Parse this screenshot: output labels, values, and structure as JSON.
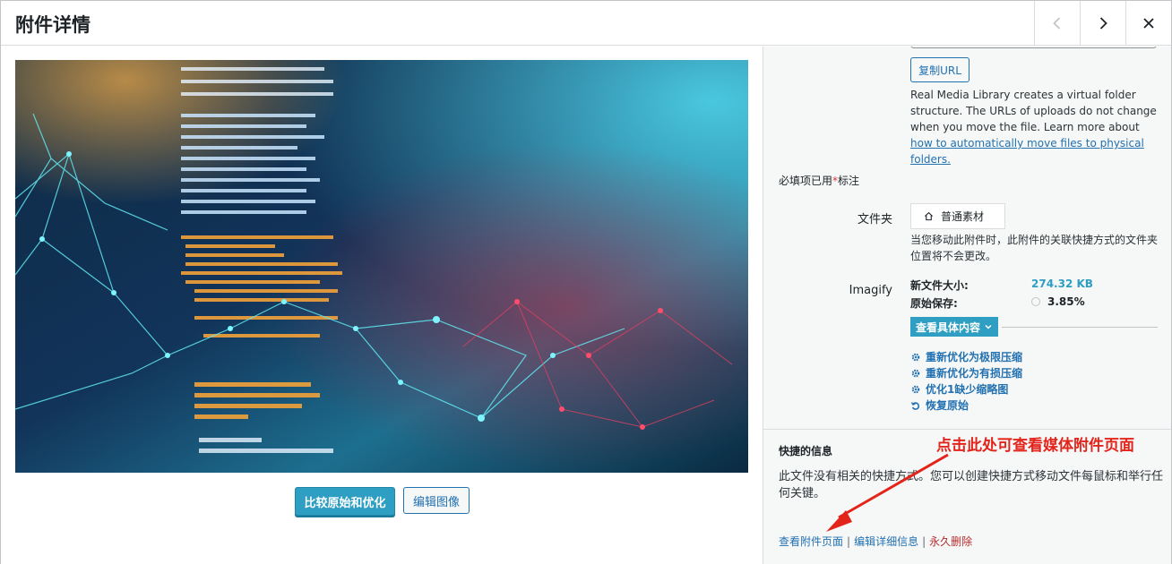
{
  "header": {
    "title": "附件详情",
    "prev_icon": "chevron-left-icon",
    "next_icon": "chevron-right-icon",
    "close_icon": "close-icon"
  },
  "image_panel": {
    "compare_button": "比较原始和优化",
    "edit_image_button": "编辑图像"
  },
  "details": {
    "copy_url_button": "复制URL",
    "rml_desc": "Real Media Library creates a virtual folder structure. The URLs of uploads do not change when you move the file. Learn more about ",
    "rml_link": "how to automatically move files to physical folders.",
    "required_prefix": "必填项已用",
    "required_star": "*",
    "required_suffix": "标注",
    "folder_label": "文件夹",
    "folder_value": "普通素材",
    "folder_icon": "home-icon",
    "folder_note": "当您移动此附件时，此附件的关联快捷方式的文件夹位置将不会更改。",
    "imagify_label": "Imagify",
    "new_size_label": "新文件大小:",
    "new_size_value": "274.32 KB",
    "original_saved_label": "原始保存:",
    "original_saved_value": "3.85%",
    "detail_button": "查看具体内容",
    "actions": [
      {
        "icon": "gear-icon",
        "label": "重新优化为极限压缩"
      },
      {
        "icon": "gear-icon",
        "label": "重新优化为有损压缩"
      },
      {
        "icon": "gear-icon",
        "label": "优化1缺少缩略图"
      },
      {
        "icon": "undo-icon",
        "label": "恢复原始"
      }
    ],
    "shortcut_title": "快捷的信息",
    "shortcut_desc": "此文件没有相关的快捷方式。您可以创建快捷方式移动文件每鼠标和举行任何关键。",
    "link_view": "查看附件页面",
    "link_edit": "编辑详细信息",
    "link_delete": "永久删除",
    "link_sep": "|"
  },
  "annotation": {
    "text": "点击此处可查看媒体附件页面"
  },
  "colors": {
    "accent": "#2e9fc2",
    "link": "#2271b1",
    "danger": "#b32d2e",
    "annotation": "#e3241b"
  }
}
